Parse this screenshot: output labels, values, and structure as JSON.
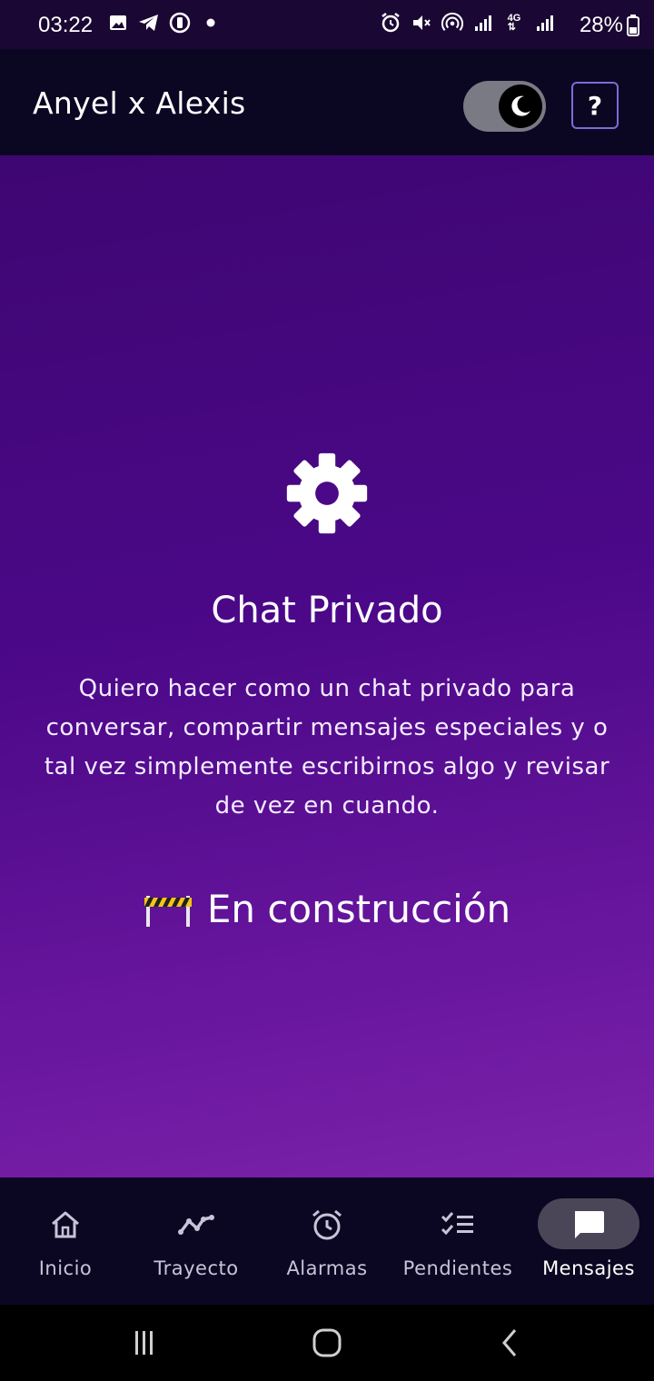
{
  "status_bar": {
    "time": "03:22",
    "battery": "28%",
    "left_icons": [
      "gallery-icon",
      "telegram-icon",
      "notification-icon",
      "dot-icon"
    ],
    "right_icons": [
      "alarm-icon",
      "mute-icon",
      "hotspot-icon",
      "signal-icon",
      "4g-icon",
      "signal-icon"
    ]
  },
  "app_bar": {
    "title": "Anyel x Alexis",
    "theme_toggle_icon": "moon-icon",
    "help_label": "?"
  },
  "content": {
    "icon": "gear-icon",
    "heading": "Chat Privado",
    "description": "Quiero hacer como un chat privado para conversar, compartir mensajes especiales y o tal vez simplemente escribirnos algo y revisar de vez en cuando.",
    "status_icon": "construction-barrier-icon",
    "status_text": "En construcción"
  },
  "bottom_nav": {
    "active": "Mensajes",
    "items": [
      {
        "label": "Inicio",
        "icon": "home-icon"
      },
      {
        "label": "Trayecto",
        "icon": "trend-icon"
      },
      {
        "label": "Alarmas",
        "icon": "alarm-clock-icon"
      },
      {
        "label": "Pendientes",
        "icon": "checklist-icon"
      },
      {
        "label": "Mensajes",
        "icon": "chat-icon"
      }
    ]
  },
  "colors": {
    "accent": "#7e6ad8",
    "bar_bg": "#0b0722",
    "gradient_top": "#3e0672",
    "gradient_bottom": "#7b22aa"
  }
}
